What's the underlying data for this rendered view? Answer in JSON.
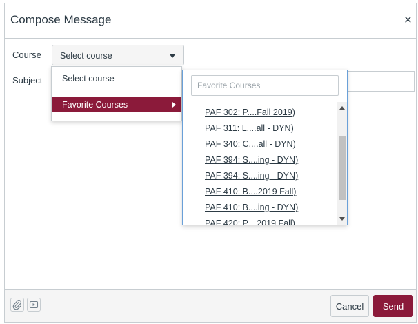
{
  "dialog": {
    "title": "Compose Message",
    "close_glyph": "×"
  },
  "form": {
    "course_label": "Course",
    "course_value": "Select course",
    "subject_label": "Subject"
  },
  "course_menu": {
    "option_select": "Select course",
    "option_favorites": "Favorite Courses"
  },
  "favorites": {
    "search_placeholder": "Favorite Courses",
    "items": [
      "PAF 302: P....Fall 2019)",
      "PAF 311: L....all - DYN)",
      "PAF 340: C....all - DYN)",
      "PAF 394: S....ing - DYN)",
      "PAF 394: S....ing - DYN)",
      "PAF 410: B....2019 Fall)",
      "PAF 410: B....ing - DYN)",
      "PAF 420: P....2019 Fall)"
    ]
  },
  "footer": {
    "attach_icon": "paperclip-icon",
    "media_icon": "media-icon",
    "cancel_label": "Cancel",
    "send_label": "Send"
  },
  "colors": {
    "accent": "#8b1a3a",
    "border": "#c7cdd1",
    "focus": "#6aa0d8"
  }
}
